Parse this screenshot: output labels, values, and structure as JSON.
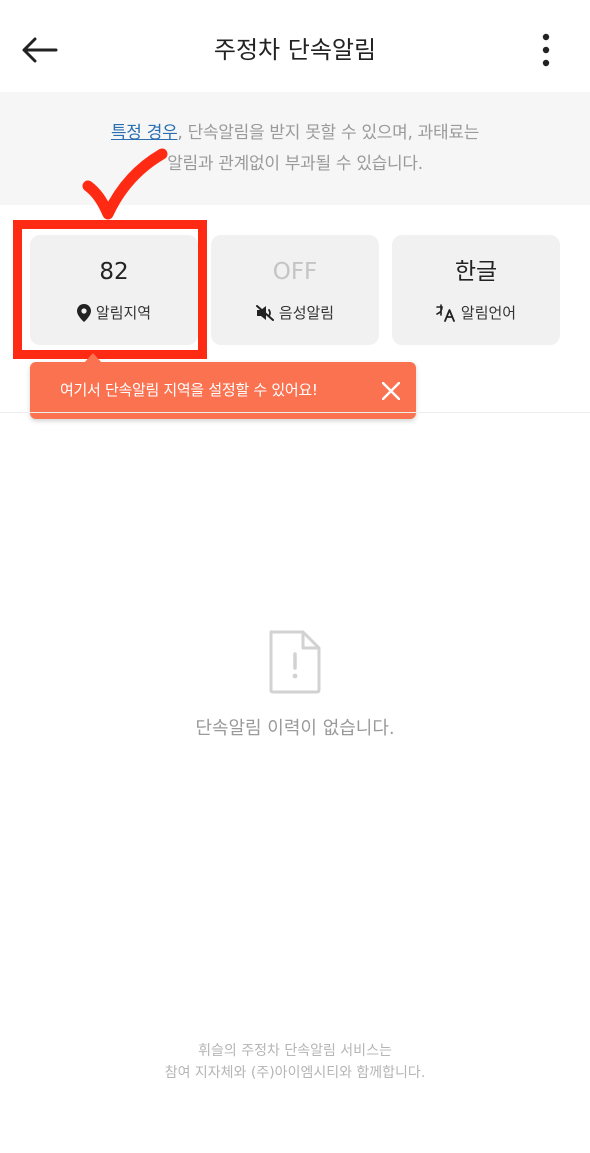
{
  "header": {
    "title": "주정차 단속알림",
    "back_icon": "arrow-left-icon",
    "more_icon": "more-vertical-icon"
  },
  "notice": {
    "link_text": "특정 경우",
    "line1_rest": ", 단속알림을 받지 못할 수 있으며, 과태료는",
    "line2": "알림과 관계없이 부과될 수 있습니다."
  },
  "cards": [
    {
      "value": "82",
      "label": "알림지역",
      "icon": "map-pin-icon"
    },
    {
      "value": "OFF",
      "label": "음성알림",
      "icon": "speaker-mute-icon"
    },
    {
      "value": "한글",
      "label": "알림언어",
      "icon": "translate-icon"
    }
  ],
  "tooltip": {
    "text": "여기서 단속알림 지역을 설정할 수 있어요!",
    "close_icon": "close-icon"
  },
  "empty_state": {
    "icon": "file-alert-icon",
    "text": "단속알림 이력이 없습니다."
  },
  "footer": {
    "line1": "휘슬의 주정차 단속알림 서비스는",
    "line2": "참여 지자체와 (주)아이엠시티와 함께합니다."
  },
  "colors": {
    "tooltip_bg": "#fa7250",
    "highlight_red": "#ff2a14",
    "link_blue": "#2b6fb0",
    "card_bg": "#f1f1f1"
  }
}
